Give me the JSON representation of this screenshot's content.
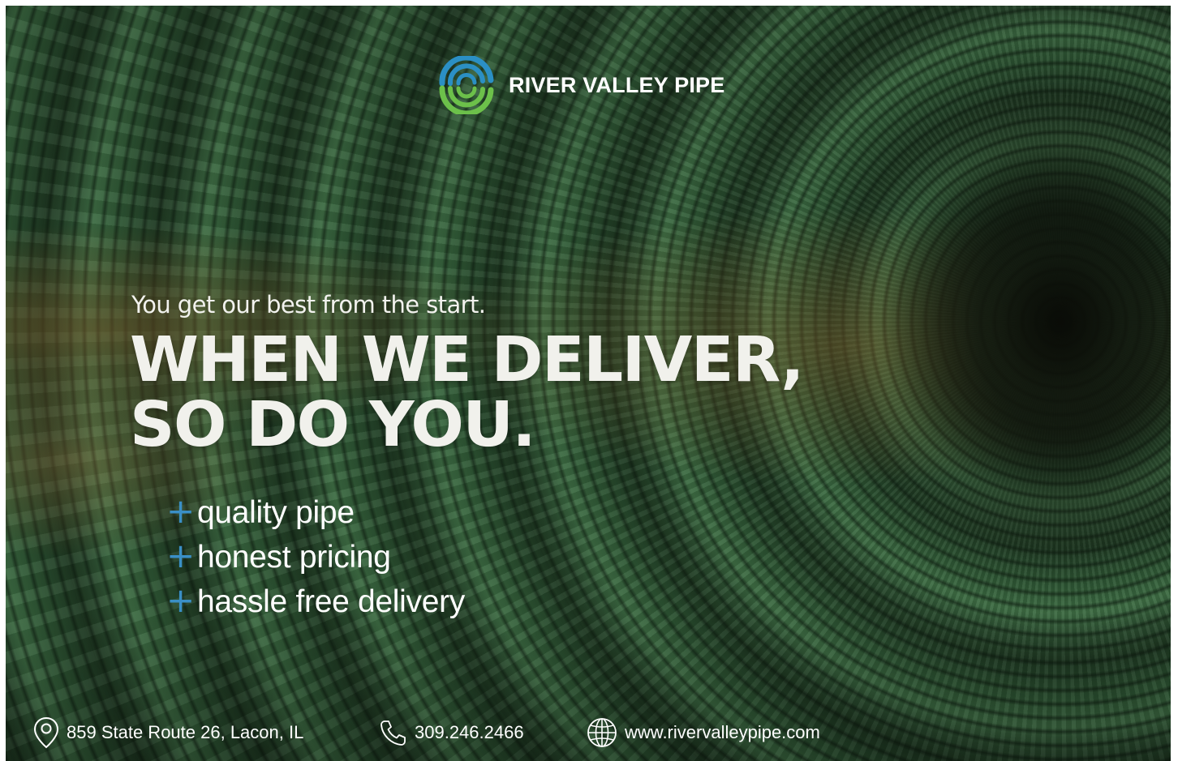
{
  "brand": {
    "name": "RIVER VALLEY PIPE",
    "colors": {
      "blue": "#2b8fc4",
      "green": "#6cc04a",
      "accent_plus": "#3a8fc6"
    }
  },
  "hero": {
    "tagline": "You get our best from the start.",
    "headline_line1": "WHEN WE DELIVER,",
    "headline_line2": "SO DO YOU."
  },
  "features": [
    {
      "icon": "plus-icon",
      "label": "quality pipe"
    },
    {
      "icon": "plus-icon",
      "label": "honest pricing"
    },
    {
      "icon": "plus-icon",
      "label": "hassle free delivery"
    }
  ],
  "contact": {
    "address": {
      "icon": "location-pin-icon",
      "text": "859 State Route 26, Lacon, IL"
    },
    "phone": {
      "icon": "phone-icon",
      "text": "309.246.2466"
    },
    "website": {
      "icon": "globe-icon",
      "text": "www.rivervalleypipe.com"
    }
  }
}
